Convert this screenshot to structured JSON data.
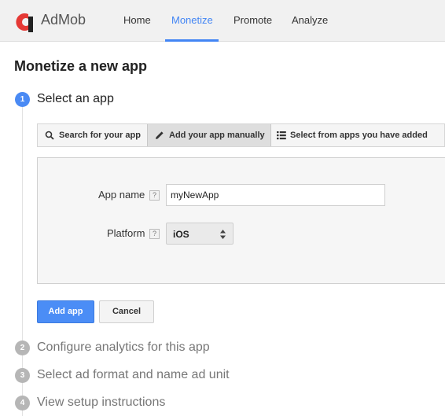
{
  "brand": {
    "name": "AdMob"
  },
  "nav": {
    "home": "Home",
    "monetize": "Monetize",
    "promote": "Promote",
    "analyze": "Analyze",
    "active": "Monetize"
  },
  "page": {
    "title": "Monetize a new app"
  },
  "steps": [
    {
      "number": "1",
      "label": "Select an app",
      "state": "active"
    },
    {
      "number": "2",
      "label": "Configure analytics for this app",
      "state": "inactive"
    },
    {
      "number": "3",
      "label": "Select ad format and name ad unit",
      "state": "inactive"
    },
    {
      "number": "4",
      "label": "View setup instructions",
      "state": "inactive"
    }
  ],
  "source_tabs": [
    {
      "label": "Search for your app",
      "icon": "search-icon"
    },
    {
      "label": "Add your app manually",
      "icon": "pencil-icon",
      "selected": true
    },
    {
      "label": "Select from apps you have added",
      "icon": "list-icon"
    }
  ],
  "form": {
    "app_name_label": "App name",
    "app_name_value": "myNewApp",
    "platform_label": "Platform",
    "platform_value": "iOS",
    "help_glyph": "?"
  },
  "actions": {
    "add": "Add app",
    "cancel": "Cancel"
  },
  "colors": {
    "accent": "#4285f4",
    "primary_button": "#4b8df6",
    "logo_red": "#e53935"
  }
}
